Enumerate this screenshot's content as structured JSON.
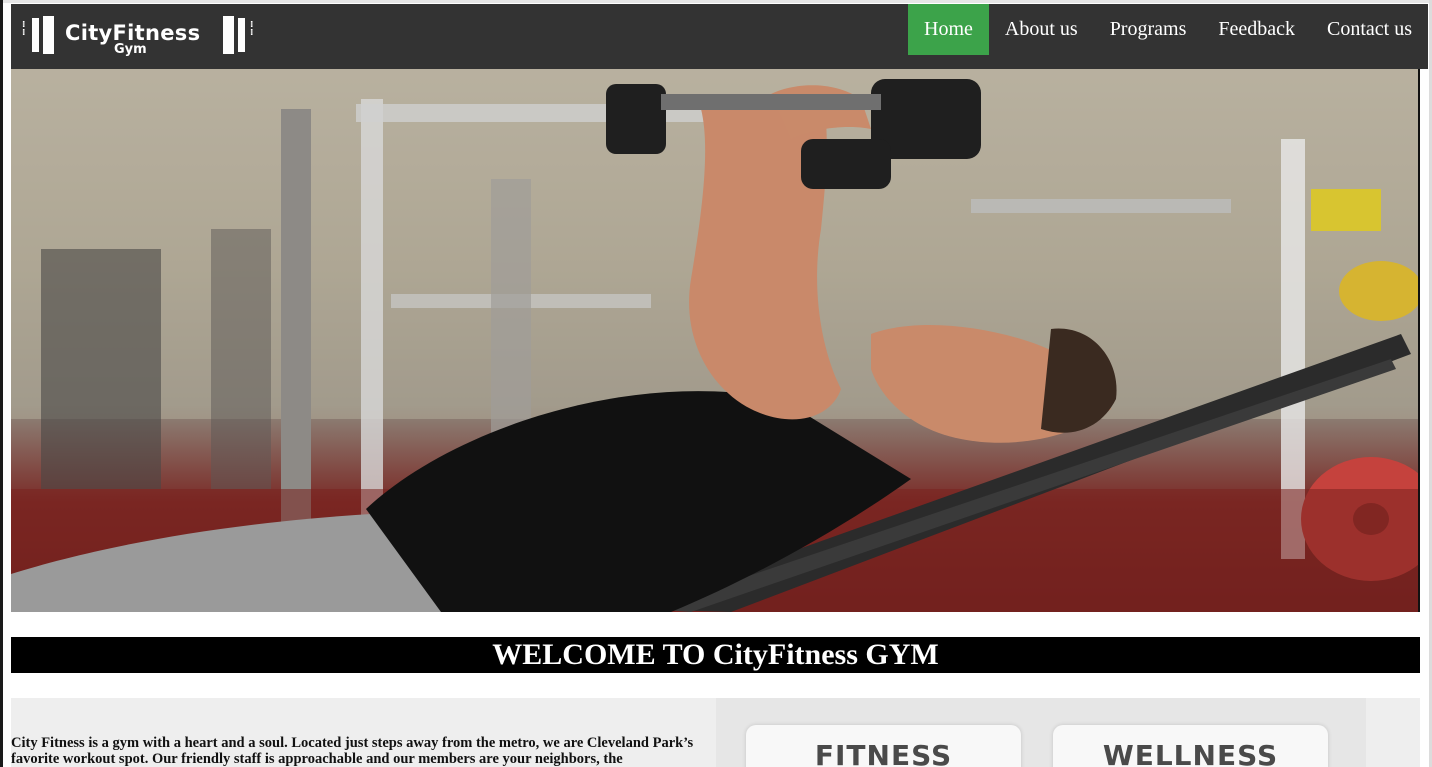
{
  "brand": {
    "name": "CityFitness",
    "sub": "Gym"
  },
  "nav": {
    "items": [
      {
        "label": "Home",
        "active": true
      },
      {
        "label": "About us",
        "active": false
      },
      {
        "label": "Programs",
        "active": false
      },
      {
        "label": "Feedback",
        "active": false
      },
      {
        "label": "Contact us",
        "active": false
      }
    ]
  },
  "welcome": {
    "title": "WELCOME TO CityFitness GYM"
  },
  "intro": {
    "text": "City Fitness is a gym with a heart and a soul. Located just steps away from the metro, we are Cleveland Park’s favorite workout spot. Our friendly staff is approachable and our members are your neighbors, the"
  },
  "cards": [
    {
      "label": "FITNESS"
    },
    {
      "label": "WELLNESS"
    }
  ],
  "colors": {
    "navbar": "#333333",
    "active": "#3ca34a",
    "welcome_bg": "#000000"
  }
}
